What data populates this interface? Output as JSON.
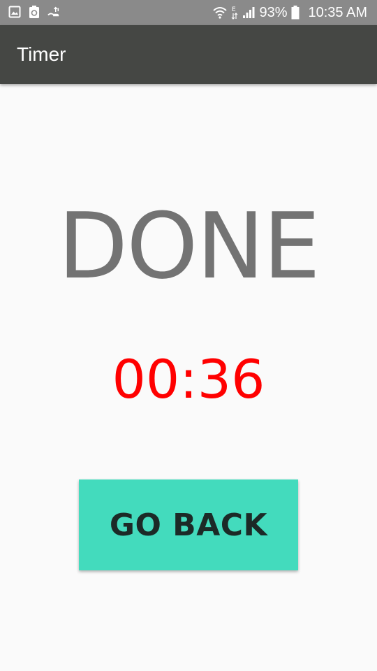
{
  "status_bar": {
    "left_icons": [
      "gallery-icon",
      "recycle-clipboard-icon",
      "hand-upload-icon"
    ],
    "right_icons": [
      "wifi-icon",
      "network-e-icon",
      "signal-icon",
      "battery-icon"
    ],
    "battery": "93%",
    "time": "10:35 AM"
  },
  "app_bar": {
    "title": "Timer"
  },
  "main": {
    "status": "DONE",
    "elapsed": "00:36",
    "button_label": "GO BACK"
  },
  "colors": {
    "status_bar": "#8a8a8a",
    "app_bar": "#454744",
    "background": "#fafafa",
    "done_text": "#737373",
    "timer_text": "#ff0000",
    "button": "#43dbbd",
    "button_text": "#1c2a27"
  }
}
